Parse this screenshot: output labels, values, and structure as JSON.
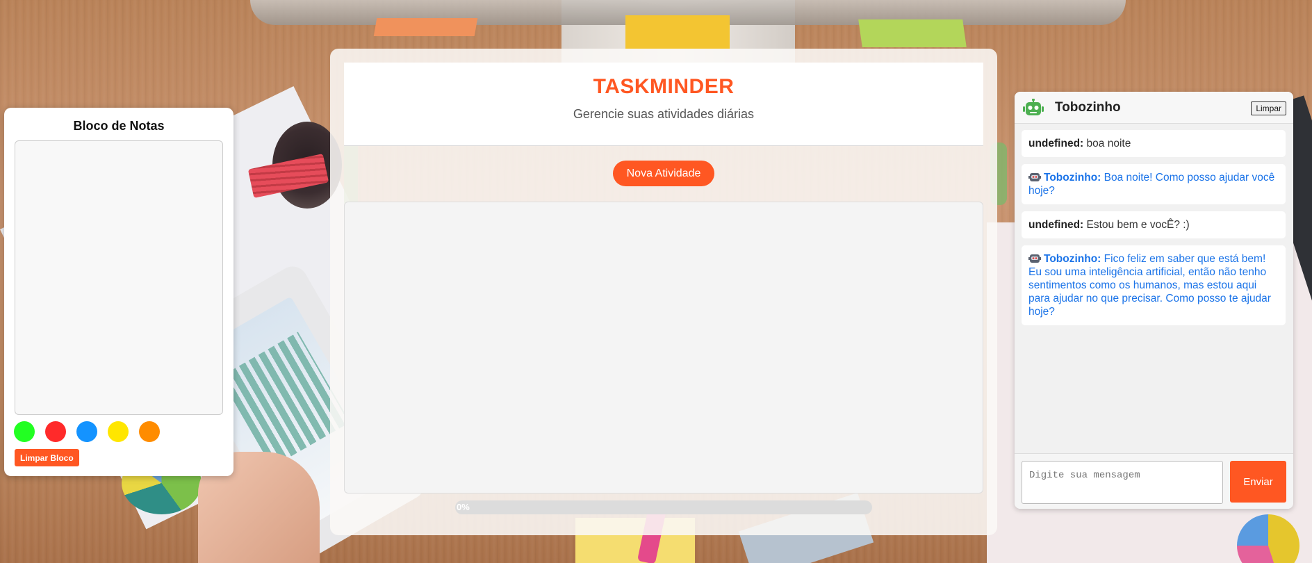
{
  "notes": {
    "title": "Bloco de Notas",
    "content": "",
    "colors": [
      {
        "name": "green",
        "hex": "#22ff22"
      },
      {
        "name": "red",
        "hex": "#ff2a2a"
      },
      {
        "name": "blue",
        "hex": "#1493ff"
      },
      {
        "name": "yellow",
        "hex": "#ffe600"
      },
      {
        "name": "orange",
        "hex": "#ff8c00"
      }
    ],
    "clear_label": "Limpar Bloco"
  },
  "main": {
    "title": "TASKMINDER",
    "subtitle": "Gerencie suas atividades diárias",
    "new_activity_label": "Nova Atividade",
    "progress": {
      "percent": 0,
      "text": "0%"
    }
  },
  "chat": {
    "bot_name": "Tobozinho",
    "clear_label": "Limpar",
    "messages": [
      {
        "author": "undefined:",
        "text": "boa noite",
        "type": "user"
      },
      {
        "author": "Tobozinho:",
        "text": "Boa noite! Como posso ajudar você hoje?",
        "type": "bot"
      },
      {
        "author": "undefined:",
        "text": "Estou bem e vocÊ? :)",
        "type": "user"
      },
      {
        "author": "Tobozinho:",
        "text": "Fico feliz em saber que está bem! Eu sou uma inteligência artificial, então não tenho sentimentos como os humanos, mas estou aqui para ajudar no que precisar. Como posso te ajudar hoje?",
        "type": "bot"
      }
    ],
    "input": {
      "placeholder": "Digite sua mensagem",
      "value": ""
    },
    "send_label": "Enviar"
  },
  "colors": {
    "accent": "#ff5722",
    "bot_text": "#1a73e8",
    "robot_icon": "#4caf50"
  },
  "icons": {
    "chat_header": "robot-icon",
    "bot_message": "robot-icon"
  }
}
